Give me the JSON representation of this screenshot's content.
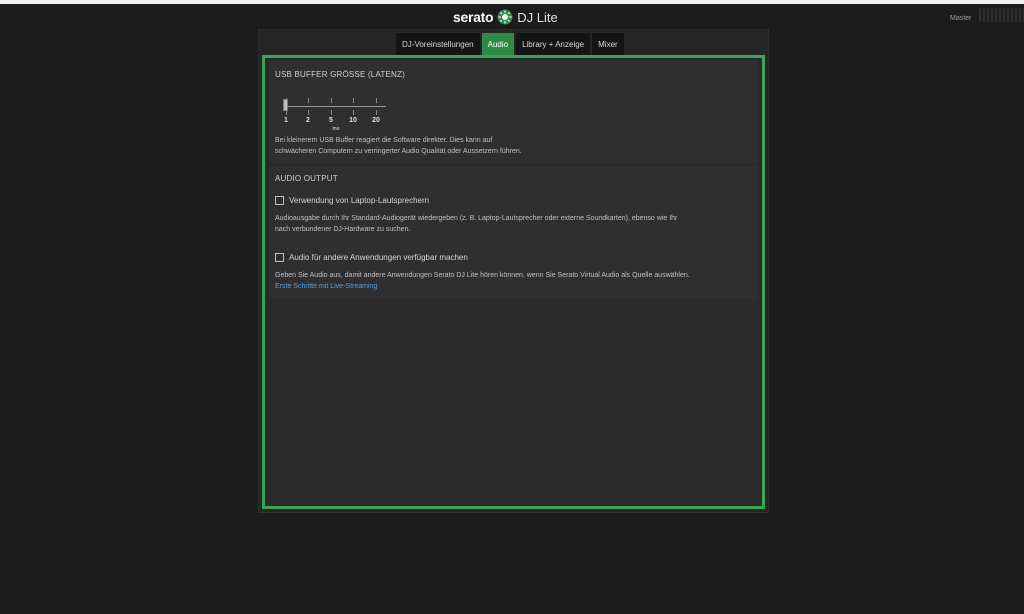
{
  "header": {
    "brand": "serato",
    "product": "DJ Lite",
    "master_label": "Master"
  },
  "tabs": [
    {
      "label": "DJ-Voreinstellungen",
      "active": false
    },
    {
      "label": "Audio",
      "active": true
    },
    {
      "label": "Library + Anzeige",
      "active": false
    },
    {
      "label": "Mixer",
      "active": false
    }
  ],
  "usb_buffer": {
    "title": "USB BUFFER GRÖSSE (LATENZ)",
    "ticks": [
      "1",
      "2",
      "5",
      "10",
      "20"
    ],
    "unit": "ms",
    "selected": "1",
    "description_line1": "Bei kleinerem USB Buffer reagiert die Software direkter. Dies kann auf",
    "description_line2": "schwächeren Computern zu verringerter Audio Qualität oder Aussetzern führen."
  },
  "audio_output": {
    "title": "AUDIO OUTPUT",
    "option1": {
      "label": "Verwendung von Laptop-Lautsprechern",
      "checked": false,
      "description_line1": "Audioausgabe durch Ihr Standard-Audiogerät wiedergeben (z. B. Laptop-Lautsprecher oder externe Soundkarten), ebenso wie Ihr",
      "description_line2": "nach verbundener DJ-Hardware zu suchen."
    },
    "option2": {
      "label": "Audio für andere Anwendungen verfügbar machen",
      "checked": false,
      "description": "Geben Sie Audio aus, damit andere Anwendungen Serato DJ Lite hören können, wenn Sie Serato Virtual Audio als Quelle auswählen.",
      "link": "Erste Schritte mit Live-Streaming"
    }
  },
  "colors": {
    "accent": "#34a853",
    "active_tab": "#2f8a43",
    "link": "#4aa3f0",
    "background": "#1c1c1c"
  }
}
